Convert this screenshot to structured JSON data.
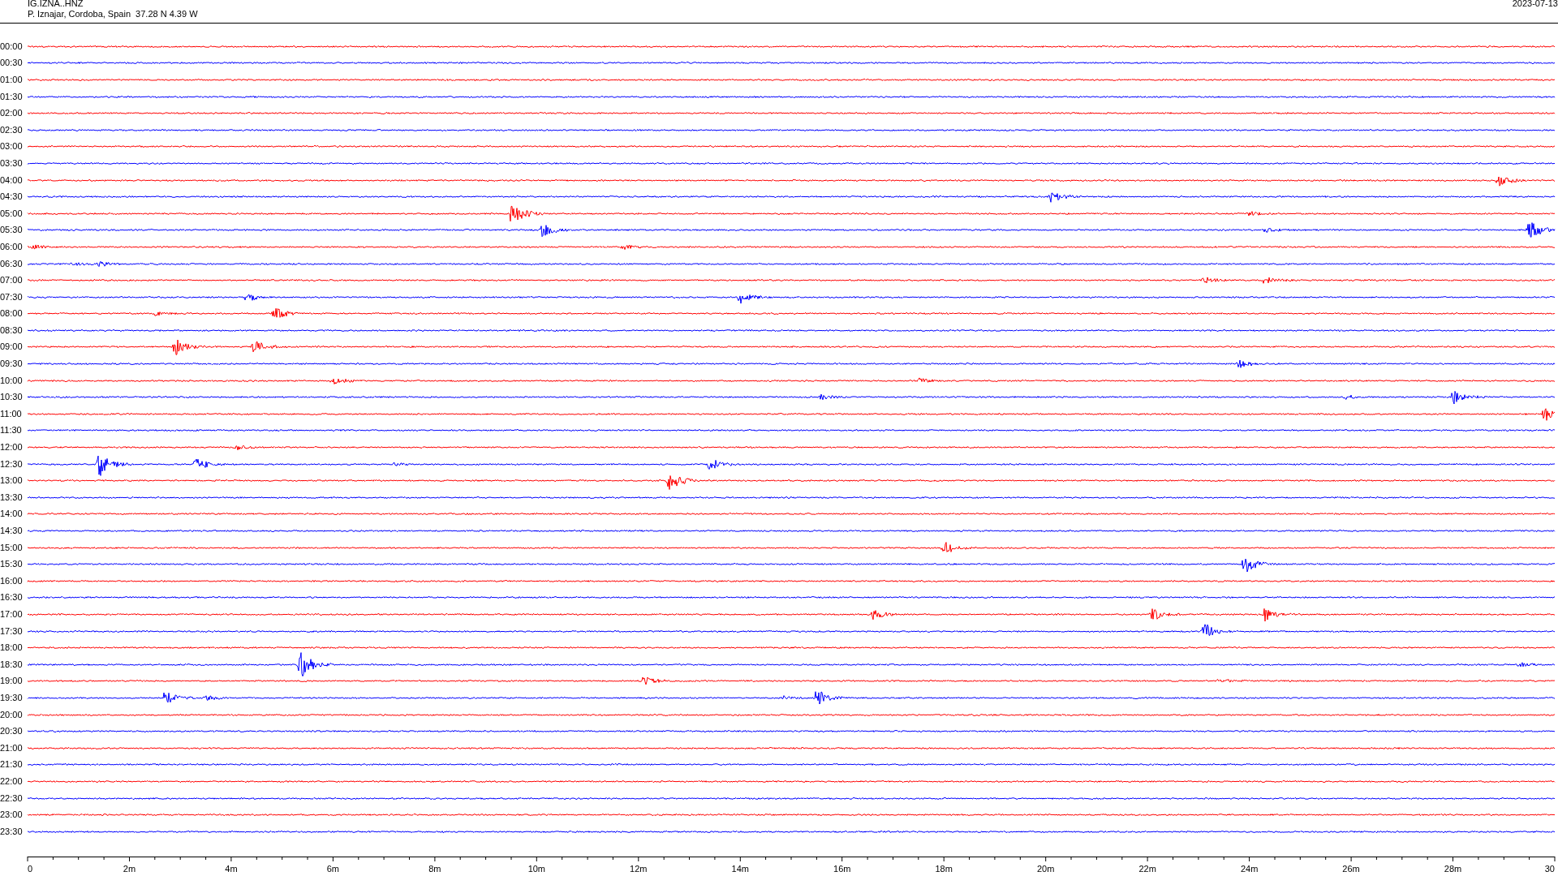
{
  "header": {
    "station": "IG.IZNA..HNZ",
    "location": "P. Iznajar, Cordoba, Spain  37.28 N 4.39 W",
    "date": "2023-07-13"
  },
  "rows": [
    {
      "time": "00:00",
      "color": "#ff0000"
    },
    {
      "time": "00:30",
      "color": "#0000ff"
    },
    {
      "time": "01:00",
      "color": "#ff0000"
    },
    {
      "time": "01:30",
      "color": "#0000ff"
    },
    {
      "time": "02:00",
      "color": "#ff0000"
    },
    {
      "time": "02:30",
      "color": "#0000ff"
    },
    {
      "time": "03:00",
      "color": "#ff0000"
    },
    {
      "time": "03:30",
      "color": "#0000ff"
    },
    {
      "time": "04:00",
      "color": "#ff0000"
    },
    {
      "time": "04:30",
      "color": "#0000ff"
    },
    {
      "time": "05:00",
      "color": "#ff0000"
    },
    {
      "time": "05:30",
      "color": "#0000ff"
    },
    {
      "time": "06:00",
      "color": "#ff0000"
    },
    {
      "time": "06:30",
      "color": "#0000ff"
    },
    {
      "time": "07:00",
      "color": "#ff0000"
    },
    {
      "time": "07:30",
      "color": "#0000ff"
    },
    {
      "time": "08:00",
      "color": "#ff0000"
    },
    {
      "time": "08:30",
      "color": "#0000ff"
    },
    {
      "time": "09:00",
      "color": "#ff0000"
    },
    {
      "time": "09:30",
      "color": "#0000ff"
    },
    {
      "time": "10:00",
      "color": "#ff0000"
    },
    {
      "time": "10:30",
      "color": "#0000ff"
    },
    {
      "time": "11:00",
      "color": "#ff0000"
    },
    {
      "time": "11:30",
      "color": "#0000ff"
    },
    {
      "time": "12:00",
      "color": "#ff0000"
    },
    {
      "time": "12:30",
      "color": "#0000ff"
    },
    {
      "time": "13:00",
      "color": "#ff0000"
    },
    {
      "time": "13:30",
      "color": "#0000ff"
    },
    {
      "time": "14:00",
      "color": "#ff0000"
    },
    {
      "time": "14:30",
      "color": "#0000ff"
    },
    {
      "time": "15:00",
      "color": "#ff0000"
    },
    {
      "time": "15:30",
      "color": "#0000ff"
    },
    {
      "time": "16:00",
      "color": "#ff0000"
    },
    {
      "time": "16:30",
      "color": "#0000ff"
    },
    {
      "time": "17:00",
      "color": "#ff0000"
    },
    {
      "time": "17:30",
      "color": "#0000ff"
    },
    {
      "time": "18:00",
      "color": "#ff0000"
    },
    {
      "time": "18:30",
      "color": "#0000ff"
    },
    {
      "time": "19:00",
      "color": "#ff0000"
    },
    {
      "time": "19:30",
      "color": "#0000ff"
    },
    {
      "time": "20:00",
      "color": "#ff0000"
    },
    {
      "time": "20:30",
      "color": "#0000ff"
    },
    {
      "time": "21:00",
      "color": "#ff0000"
    },
    {
      "time": "21:30",
      "color": "#0000ff"
    },
    {
      "time": "22:00",
      "color": "#ff0000"
    },
    {
      "time": "22:30",
      "color": "#0000ff"
    },
    {
      "time": "23:00",
      "color": "#ff0000"
    },
    {
      "time": "23:30",
      "color": "#0000ff"
    }
  ],
  "x_axis": {
    "labels": [
      "0",
      "2m",
      "4m",
      "6m",
      "8m",
      "10m",
      "12m",
      "14m",
      "16m",
      "18m",
      "20m",
      "22m",
      "24m",
      "26m",
      "28m",
      "30"
    ]
  }
}
